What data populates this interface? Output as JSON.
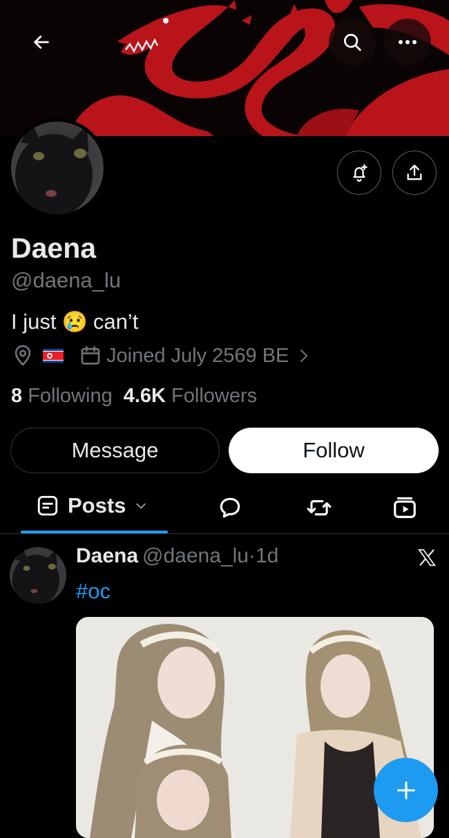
{
  "header": {
    "back_icon": "arrow-left-icon",
    "search_icon": "search-icon",
    "more_icon": "more-horizontal-icon",
    "notify_icon": "bell-plus-icon",
    "share_icon": "share-upload-icon"
  },
  "profile": {
    "name": "Daena",
    "handle": "@daena_lu",
    "bio_start": "I just",
    "bio_emoji": "😢",
    "bio_end": "can’t",
    "joined": "Joined July 2569 BE",
    "following_count": "8",
    "following_label": "Following",
    "followers_count": "4.6K",
    "followers_label": "Followers"
  },
  "actions": {
    "message_label": "Message",
    "follow_label": "Follow"
  },
  "tabs": {
    "posts_label": "Posts"
  },
  "post": {
    "name": "Daena",
    "handle": "@daena_lu",
    "separator": "·",
    "time": "1d",
    "hashtag": "#oc"
  },
  "colors": {
    "accent": "#1d9bf0",
    "banner_red": "#b8141a",
    "muted": "#71767b"
  }
}
